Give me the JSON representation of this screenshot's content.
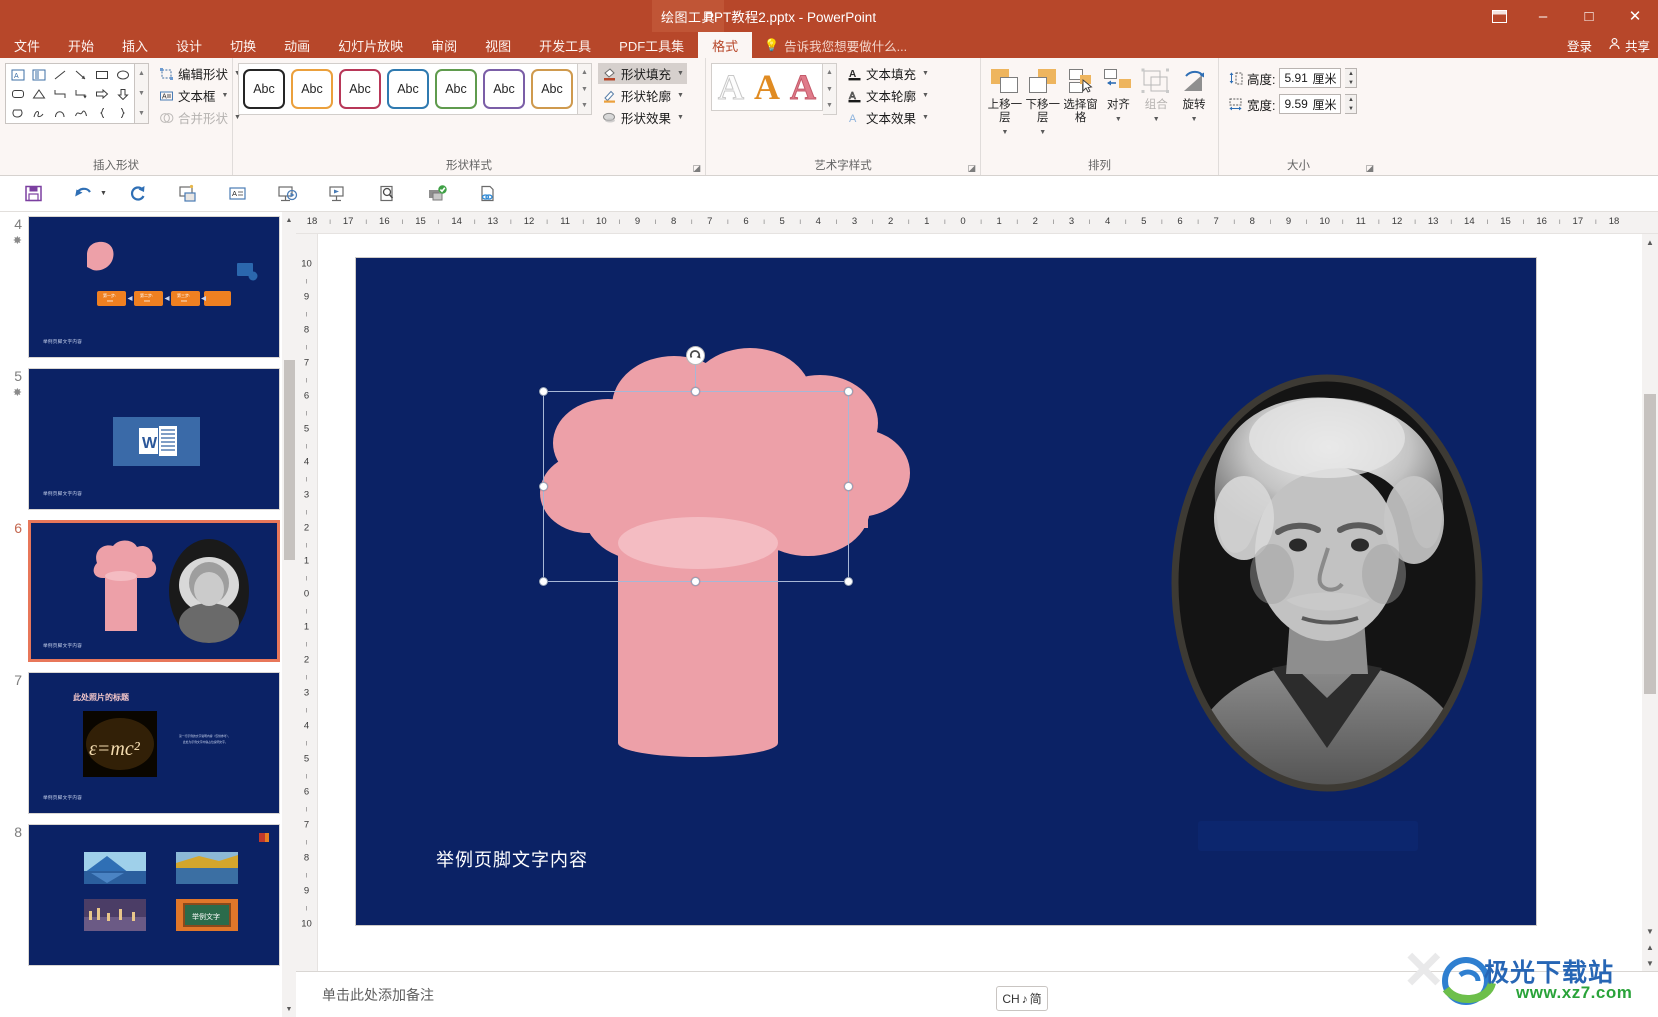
{
  "titlebar": {
    "context_tab": "绘图工具",
    "document_title": "PPT教程2.pptx - PowerPoint",
    "ribbon_display_icon": "ribbon-display-options-icon",
    "minimize": "–",
    "maximize": "□",
    "close": "✕"
  },
  "tabs": [
    {
      "label": "文件",
      "active": false
    },
    {
      "label": "开始",
      "active": false
    },
    {
      "label": "插入",
      "active": false
    },
    {
      "label": "设计",
      "active": false
    },
    {
      "label": "切换",
      "active": false
    },
    {
      "label": "动画",
      "active": false
    },
    {
      "label": "幻灯片放映",
      "active": false
    },
    {
      "label": "审阅",
      "active": false
    },
    {
      "label": "视图",
      "active": false
    },
    {
      "label": "开发工具",
      "active": false
    },
    {
      "label": "PDF工具集",
      "active": false
    },
    {
      "label": "格式",
      "active": true
    }
  ],
  "tellme": {
    "placeholder": "告诉我您想要做什么...",
    "icon": "lightbulb-icon"
  },
  "account": {
    "signin": "登录",
    "share": "共享",
    "share_icon": "share-person-icon"
  },
  "ribbon": {
    "groups": [
      {
        "name": "insert-shapes",
        "title": "插入形状",
        "commands": [
          {
            "label": "编辑形状",
            "icon": "edit-shape-icon",
            "dropdown": true,
            "disabled": false
          },
          {
            "label": "文本框",
            "icon": "text-box-icon",
            "dropdown": true,
            "disabled": false
          },
          {
            "label": "合并形状",
            "icon": "merge-shapes-icon",
            "dropdown": true,
            "disabled": true
          }
        ]
      },
      {
        "name": "shape-styles",
        "title": "形状样式",
        "swatch_label": "Abc",
        "swatches": [
          {
            "color": "#252525"
          },
          {
            "color": "#eba03c"
          },
          {
            "color": "#b83758"
          },
          {
            "color": "#2f7ab0"
          },
          {
            "color": "#5f9b4d"
          },
          {
            "color": "#7b5ea7"
          },
          {
            "color": "#cf9a4e"
          }
        ],
        "commands": [
          {
            "label": "形状填充",
            "icon": "shape-fill-icon",
            "dropdown": true,
            "highlighted": true
          },
          {
            "label": "形状轮廓",
            "icon": "shape-outline-icon",
            "dropdown": true
          },
          {
            "label": "形状效果",
            "icon": "shape-effects-icon",
            "dropdown": true
          }
        ]
      },
      {
        "name": "wordart-styles",
        "title": "艺术字样式",
        "wordart_samples": [
          {
            "glyph": "A",
            "style": "outline-gray"
          },
          {
            "glyph": "A",
            "style": "filled-orange"
          },
          {
            "glyph": "A",
            "style": "filled-pink"
          }
        ],
        "commands": [
          {
            "label": "文本填充",
            "icon": "text-fill-icon",
            "dropdown": true
          },
          {
            "label": "文本轮廓",
            "icon": "text-outline-icon",
            "dropdown": true
          },
          {
            "label": "文本效果",
            "icon": "text-effects-icon",
            "dropdown": true
          }
        ]
      },
      {
        "name": "arrange",
        "title": "排列",
        "buttons": [
          {
            "label": "上移一层",
            "icon": "bring-forward-icon",
            "dropdown": true,
            "disabled": false
          },
          {
            "label": "下移一层",
            "icon": "send-backward-icon",
            "dropdown": true,
            "disabled": false
          },
          {
            "label": "选择窗格",
            "icon": "selection-pane-icon",
            "dropdown": false,
            "disabled": false
          },
          {
            "label": "对齐",
            "icon": "align-icon",
            "dropdown": true,
            "disabled": false
          },
          {
            "label": "组合",
            "icon": "group-icon",
            "dropdown": true,
            "disabled": true
          },
          {
            "label": "旋转",
            "icon": "rotate-icon",
            "dropdown": true,
            "disabled": false
          }
        ]
      },
      {
        "name": "size",
        "title": "大小",
        "height": {
          "label": "高度:",
          "value": "5.91",
          "unit": "厘米",
          "icon": "shape-height-icon"
        },
        "width": {
          "label": "宽度:",
          "value": "9.59",
          "unit": "厘米",
          "icon": "shape-width-icon"
        }
      }
    ]
  },
  "quick_toolbar": [
    {
      "name": "save-icon"
    },
    {
      "name": "undo-icon"
    },
    {
      "name": "redo-icon"
    },
    {
      "name": "start-presentation-icon"
    },
    {
      "name": "new-slide-icon"
    },
    {
      "name": "from-beginning-icon"
    },
    {
      "name": "from-current-slide-icon"
    },
    {
      "name": "print-preview-icon"
    },
    {
      "name": "export-checked-icon"
    },
    {
      "name": "hyperlink-doc-icon"
    }
  ],
  "thumbnails": [
    {
      "number": "4",
      "starred": true,
      "selected": false,
      "footer": "举例页脚文字内容",
      "kind": "process-chart"
    },
    {
      "number": "5",
      "starred": true,
      "selected": false,
      "footer": "举例页脚文字内容",
      "kind": "word-logo"
    },
    {
      "number": "6",
      "starred": false,
      "selected": true,
      "footer": "举例页脚文字内容",
      "kind": "cloud-einstein"
    },
    {
      "number": "7",
      "starred": false,
      "selected": false,
      "footer": "举例页脚文字内容",
      "kind": "emc2",
      "title": "此处照片的标题"
    },
    {
      "number": "8",
      "starred": false,
      "selected": false,
      "footer": "",
      "kind": "photo-grid",
      "caption": "举例文字"
    }
  ],
  "ruler": {
    "horizontal": [
      "18",
      "17",
      "16",
      "15",
      "14",
      "13",
      "12",
      "11",
      "10",
      "9",
      "8",
      "7",
      "6",
      "5",
      "4",
      "3",
      "2",
      "1",
      "0",
      "1",
      "2",
      "3",
      "4",
      "5",
      "6",
      "7",
      "8",
      "9",
      "10",
      "11",
      "12",
      "13",
      "14",
      "15",
      "16",
      "17",
      "18"
    ],
    "vertical": [
      "10",
      "9",
      "8",
      "7",
      "6",
      "5",
      "4",
      "3",
      "2",
      "1",
      "0",
      "1",
      "2",
      "3",
      "4",
      "5",
      "6",
      "7",
      "8",
      "9",
      "10"
    ]
  },
  "slide": {
    "background": "#0b2265",
    "footer_text": "举例页脚文字内容",
    "shape_fill": "#eda0a8",
    "selection": {
      "rotate_icon": "rotate-handle-icon",
      "handles": 8
    }
  },
  "notes": {
    "placeholder": "单击此处添加备注"
  },
  "ime": {
    "label": "CH",
    "mode_icon": "music-note-icon",
    "sub": "简"
  },
  "watermark": {
    "title": "极光下载站",
    "url": "www.xz7.com"
  }
}
